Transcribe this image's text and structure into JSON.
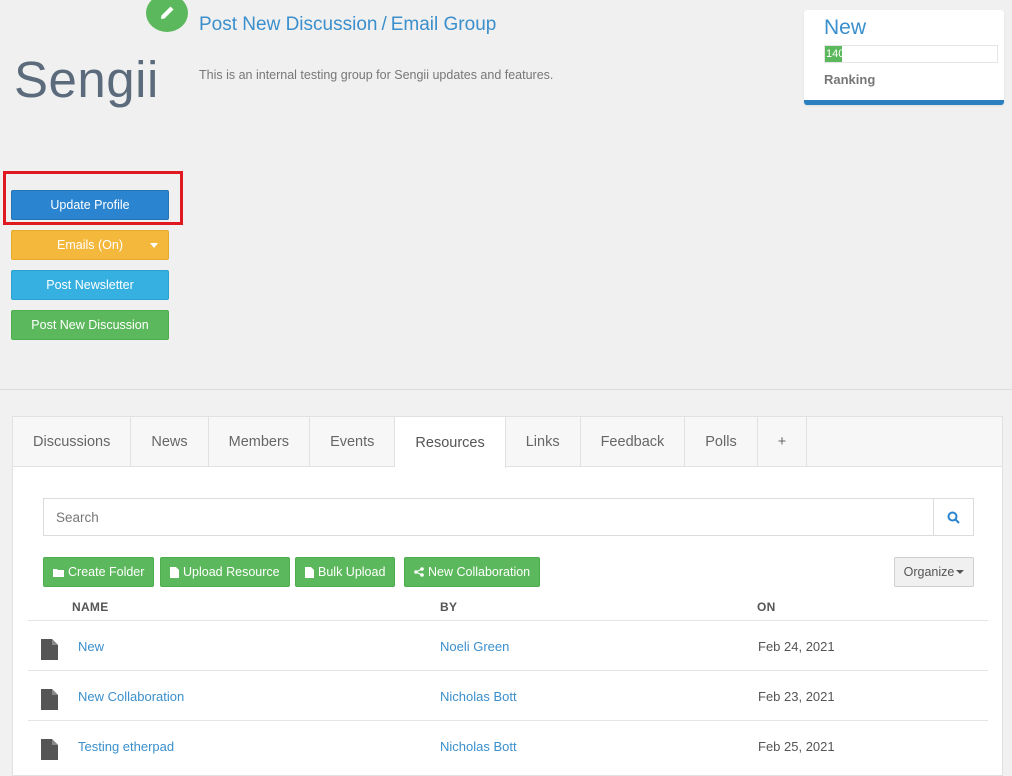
{
  "brand": {
    "logo_text": "Sengii"
  },
  "header": {
    "title_link": "Post New Discussion",
    "separator": "/",
    "group_name": "Email Group",
    "description": "This is an internal testing group for Sengii updates and features."
  },
  "ranking": {
    "title": "New",
    "value": "140",
    "label": "Ranking",
    "fill_fraction": 0.1
  },
  "sidebar": {
    "update_profile": "Update Profile",
    "emails": "Emails (On)",
    "post_newsletter": "Post Newsletter",
    "post_discussion": "Post New Discussion"
  },
  "tabs": [
    {
      "label": "Discussions"
    },
    {
      "label": "News"
    },
    {
      "label": "Members"
    },
    {
      "label": "Events"
    },
    {
      "label": "Resources",
      "active": true
    },
    {
      "label": "Links"
    },
    {
      "label": "Feedback"
    },
    {
      "label": "Polls"
    },
    {
      "label": "+"
    }
  ],
  "search": {
    "placeholder": "Search"
  },
  "actions": {
    "create_folder": "Create Folder",
    "upload_resource": "Upload Resource",
    "bulk_upload": "Bulk Upload",
    "new_collaboration": "New Collaboration",
    "organize": "Organize"
  },
  "table": {
    "columns": {
      "name": "NAME",
      "by": "BY",
      "on": "ON"
    },
    "rows": [
      {
        "name": "New",
        "by": "Noeli Green",
        "on": "Feb 24, 2021"
      },
      {
        "name": "New Collaboration",
        "by": "Nicholas Bott",
        "on": "Feb 23, 2021"
      },
      {
        "name": "Testing etherpad",
        "by": "Nicholas Bott",
        "on": "Feb 25, 2021"
      }
    ]
  },
  "colors": {
    "primary": "#2b84d0",
    "link": "#3a8fcc",
    "success": "#5cb85c",
    "warning": "#f3b83c",
    "info": "#36b0e0",
    "highlight": "#e0181f"
  }
}
